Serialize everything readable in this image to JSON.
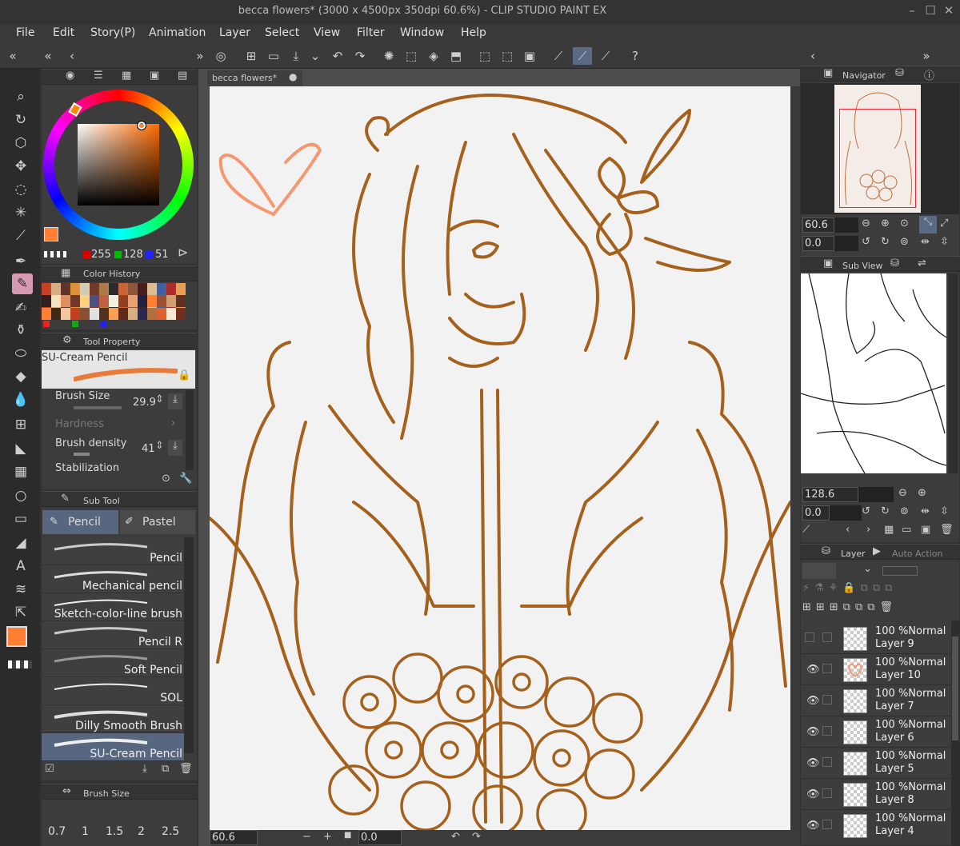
{
  "window": {
    "title": "becca flowers* (3000 x 4500px 350dpi 60.6%)  - CLIP STUDIO PAINT EX"
  },
  "menu": [
    "File",
    "Edit",
    "Story(P)",
    "Animation",
    "Layer",
    "Select",
    "View",
    "Filter",
    "Window",
    "Help"
  ],
  "document_tab": "becca flowers*",
  "color": {
    "r": "255",
    "g": "128",
    "b": "51",
    "main": "#ff8033"
  },
  "color_history": {
    "title": "Color History"
  },
  "tool_property": {
    "title": "Tool Property",
    "brush_name": "SU-Cream Pencil",
    "brush_size_label": "Brush Size",
    "brush_size_value": "29.9",
    "hardness_label": "Hardness",
    "density_label": "Brush density",
    "density_value": "41",
    "stabilization_label": "Stabilization"
  },
  "sub_tool": {
    "title": "Sub Tool",
    "tabs": [
      "Pencil",
      "Pastel"
    ],
    "brushes": [
      "Pencil",
      "Mechanical pencil",
      "Sketch-color-line brush",
      "Pencil R",
      "Soft Pencil",
      "SOL",
      "Dilly Smooth Brush",
      "SU-Cream Pencil"
    ]
  },
  "brush_size_panel": {
    "title": "Brush Size",
    "sizes": [
      "0.7",
      "1",
      "1.5",
      "2",
      "2.5"
    ]
  },
  "navigator": {
    "title": "Navigator",
    "zoom": "60.6",
    "angle": "0.0"
  },
  "sub_view": {
    "title": "Sub View",
    "zoom": "128.6",
    "angle": "0.0"
  },
  "layer_panel": {
    "tabs": [
      "Layer",
      "Auto Action"
    ],
    "layers": [
      {
        "opacity": "100 %Normal",
        "name": "Layer 9",
        "visible": false
      },
      {
        "opacity": "100 %Normal",
        "name": "Layer 10",
        "visible": true
      },
      {
        "opacity": "100 %Normal",
        "name": "Layer 7",
        "visible": true
      },
      {
        "opacity": "100 %Normal",
        "name": "Layer 6",
        "visible": true
      },
      {
        "opacity": "100 %Normal",
        "name": "Layer 5",
        "visible": true
      },
      {
        "opacity": "100 %Normal",
        "name": "Layer 8",
        "visible": true
      },
      {
        "opacity": "100 %Normal",
        "name": "Layer 4",
        "visible": true
      }
    ]
  },
  "status": {
    "zoom": "60.6",
    "angle": "0.0"
  },
  "colors": {
    "line": "#a5611c",
    "heart": "#f59870",
    "accent": "#5b6a84"
  }
}
